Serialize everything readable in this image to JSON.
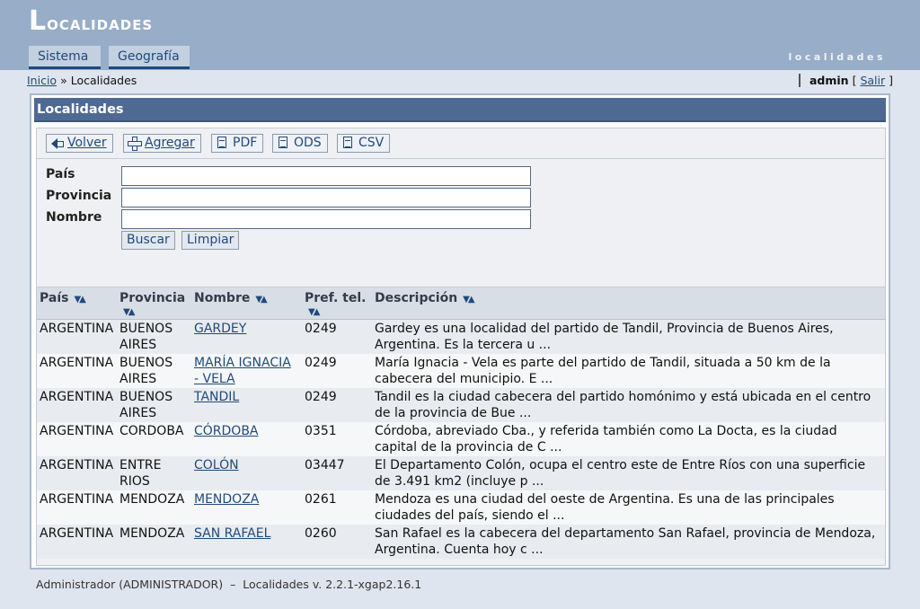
{
  "app": {
    "title_first": "L",
    "title_rest": "ocalidades",
    "subtitle": "localidades"
  },
  "tabs": [
    {
      "label": "Sistema"
    },
    {
      "label": "Geografía"
    }
  ],
  "breadcrumb": {
    "home": "Inicio",
    "separator": "»",
    "current": "Localidades"
  },
  "user": {
    "name": "admin",
    "open_bracket": "[",
    "logout": "Salir",
    "close_bracket": "]"
  },
  "panel": {
    "title": "Localidades"
  },
  "toolbar": {
    "back_label": "Volver",
    "add_label": "Agregar",
    "pdf_label": "PDF",
    "ods_label": "ODS",
    "csv_label": "CSV"
  },
  "filters": {
    "country_label": "País",
    "province_label": "Provincia",
    "name_label": "Nombre",
    "country_value": "",
    "province_value": "",
    "name_value": "",
    "search_label": "Buscar",
    "clear_label": "Limpiar"
  },
  "table": {
    "columns": [
      "País",
      "Provincia",
      "Nombre",
      "Pref. tel.",
      "Descripción"
    ],
    "rows": [
      {
        "pais": "ARGENTINA",
        "provincia": "BUENOS AIRES",
        "nombre": "GARDEY",
        "pref": "0249",
        "descripcion": "Gardey es una localidad del partido de Tandil, Provincia de Buenos Aires, Argentina. Es la tercera u ..."
      },
      {
        "pais": "ARGENTINA",
        "provincia": "BUENOS AIRES",
        "nombre": "MARÍA IGNACIA - VELA",
        "pref": "0249",
        "descripcion": "María Ignacia - Vela es parte del partido de Tandil, situada a 50 km de la cabecera del municipio. E ..."
      },
      {
        "pais": "ARGENTINA",
        "provincia": "BUENOS AIRES",
        "nombre": "TANDIL",
        "pref": "0249",
        "descripcion": "Tandil es la ciudad cabecera del partido homónimo y está ubicada en el centro de la provincia de Bue ..."
      },
      {
        "pais": "ARGENTINA",
        "provincia": "CORDOBA",
        "nombre": "CÓRDOBA",
        "pref": "0351",
        "descripcion": "Córdoba, abreviado Cba., y referida también como La Docta, es la ciudad capital de la provincia de C ..."
      },
      {
        "pais": "ARGENTINA",
        "provincia": "ENTRE RIOS",
        "nombre": "COLÓN",
        "pref": "03447",
        "descripcion": "El Departamento Colón, ocupa el centro este de Entre Ríos con una superficie de 3.491 km2 (incluye p ..."
      },
      {
        "pais": "ARGENTINA",
        "provincia": "MENDOZA",
        "nombre": "MENDOZA",
        "pref": "0261",
        "descripcion": "Mendoza es una ciudad del oeste de Argentina. Es una de las principales ciudades del país, siendo el ..."
      },
      {
        "pais": "ARGENTINA",
        "provincia": "MENDOZA",
        "nombre": "SAN RAFAEL",
        "pref": "0260",
        "descripcion": "San Rafael es la cabecera del departamento San Rafael, provincia de Mendoza, Argentina. Cuenta hoy c ..."
      }
    ]
  },
  "footer": {
    "user": "Administrador (ADMINISTRADOR)",
    "separator": "–",
    "version": "Localidades v. 2.2.1-xgap2.16.1"
  },
  "icons": {
    "back": "back-arrow-icon",
    "add": "plus-icon",
    "export": "document-icon",
    "sort": "sort-arrows-icon"
  },
  "colors": {
    "header_bg": "#97adc8",
    "panel_title_bg": "#4f6a92",
    "link": "#1f4a7c",
    "page_bg": "#dfe5ee"
  }
}
